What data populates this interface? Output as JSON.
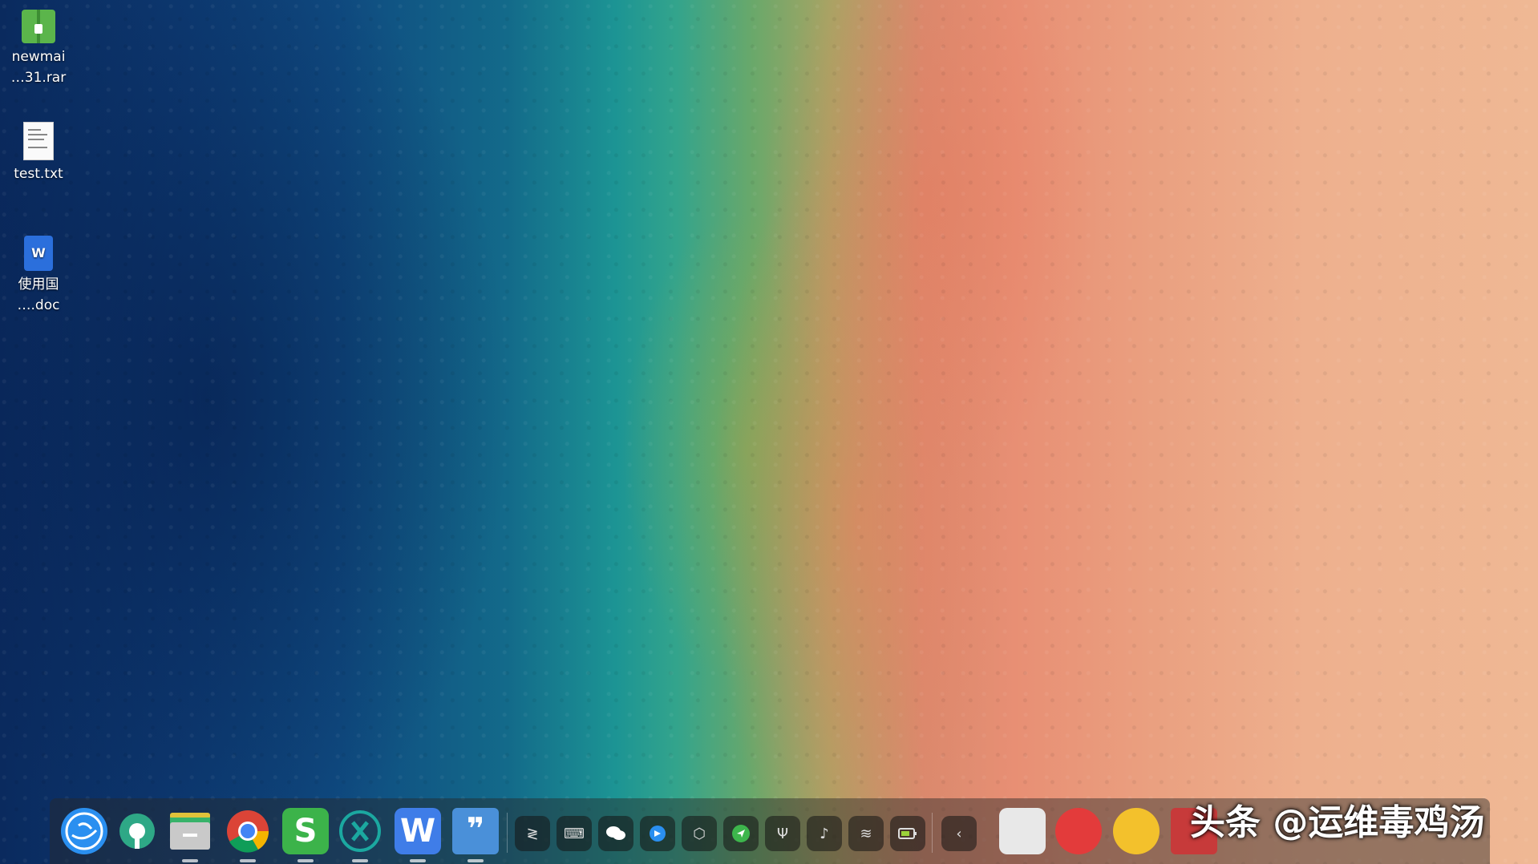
{
  "desktop": {
    "items": [
      {
        "line1": "newmai",
        "line2": "…31.rar"
      },
      {
        "line1": "test.txt",
        "line2": ""
      },
      {
        "line1": "使用国",
        "line2": "….doc"
      }
    ]
  },
  "dock": {
    "apps": [
      {
        "name": "launcher",
        "icon": "deepin-launcher-icon"
      },
      {
        "name": "control-center",
        "icon": "settings-gear-icon"
      },
      {
        "name": "file-manager",
        "icon": "folder-icon"
      },
      {
        "name": "chrome",
        "icon": "chrome-icon"
      },
      {
        "name": "wps-spreadsheet",
        "icon": "wps-s-icon"
      },
      {
        "name": "remote-desktop",
        "icon": "x-remote-icon"
      },
      {
        "name": "wps-writer",
        "icon": "wps-w-icon"
      },
      {
        "name": "text-editor",
        "icon": "quote-doc-icon"
      }
    ],
    "tray": [
      {
        "name": "terminal",
        "glyph": "≷"
      },
      {
        "name": "keyboard",
        "glyph": "⌨"
      },
      {
        "name": "wechat",
        "glyph": "●"
      },
      {
        "name": "transfer",
        "glyph": "◆"
      },
      {
        "name": "package",
        "glyph": "⬡"
      },
      {
        "name": "send",
        "glyph": "➤"
      },
      {
        "name": "usb",
        "glyph": "Ψ"
      },
      {
        "name": "volume",
        "glyph": "♪"
      },
      {
        "name": "wifi",
        "glyph": "≋"
      },
      {
        "name": "battery",
        "glyph": "▭"
      },
      {
        "name": "collapse",
        "glyph": "‹"
      }
    ]
  },
  "watermark": "头条 @运维毒鸡汤",
  "colors": {
    "accent": "#2b6fdc",
    "dock_bg": "rgba(40,40,40,0.45)"
  }
}
